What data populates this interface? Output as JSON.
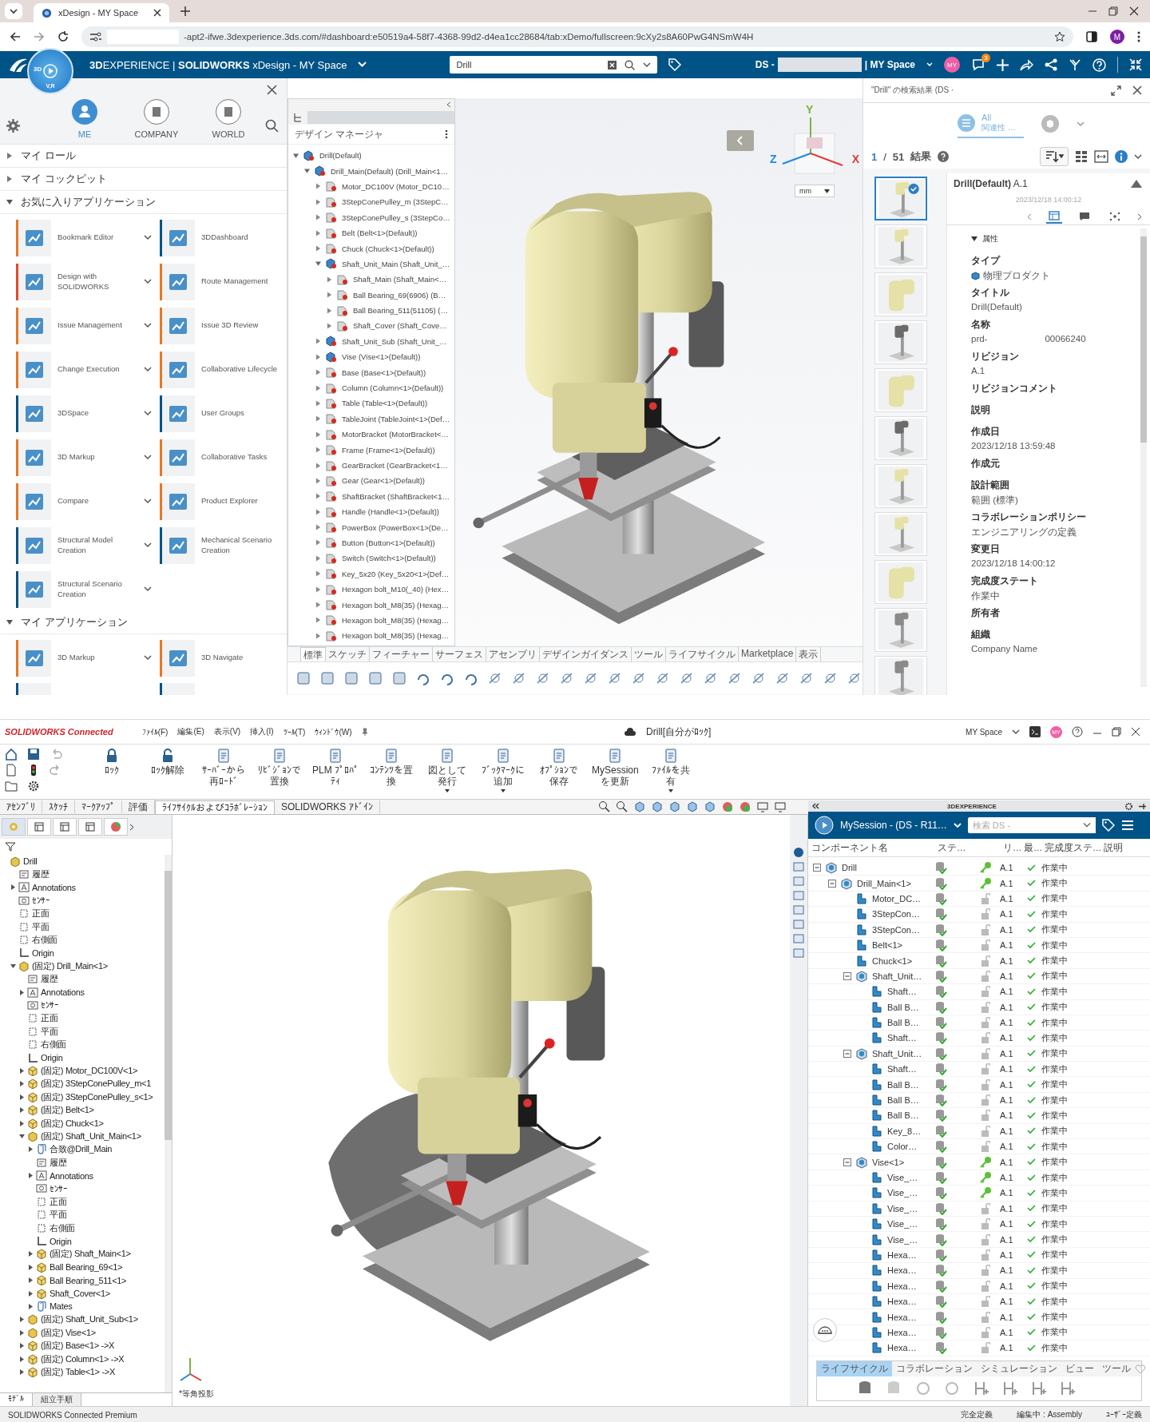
{
  "browser": {
    "tab_title": "xDesign - MY Space",
    "url": "-apt2-ifwe.3dexperience.3ds.com/#dashboard:e50519a4-58f7-4368-99d2-d4ea1cc28684/tab:xDemo/fullscreen:9cXy2s8A60PwG4NSmW4H",
    "profile": "M"
  },
  "header": {
    "title": "**3D**EXPERIENCE | **SOLIDWORKS** xDesign - MY Space",
    "compass_left": "3D",
    "compass_bottom": "V,R",
    "search_value": "Drill",
    "tenant": "DS -",
    "space": "| MY Space",
    "avatar": "MY",
    "notifications": "3"
  },
  "launcher": {
    "tabs": [
      {
        "label": "ME",
        "selected": true
      },
      {
        "label": "COMPANY",
        "selected": false
      },
      {
        "label": "WORLD",
        "selected": false
      }
    ],
    "sections": [
      {
        "title": "マイ ロール",
        "expanded": false
      },
      {
        "title": "マイ コックピット",
        "expanded": false
      },
      {
        "title": "お気に入りアプリケーション",
        "expanded": true,
        "apps": [
          {
            "name": "Bookmark Editor",
            "color": "#e87722"
          },
          {
            "name": "3DDashboard",
            "color": "#005386"
          },
          {
            "name": "Design with SOLIDWORKS",
            "color": "#e2492c"
          },
          {
            "name": "Route Management",
            "color": "#e87722"
          },
          {
            "name": "Issue Management",
            "color": "#e87722"
          },
          {
            "name": "Issue 3D Review",
            "color": "#e87722"
          },
          {
            "name": "Change Execution",
            "color": "#e87722"
          },
          {
            "name": "Collaborative Lifecycle",
            "color": "#e87722"
          },
          {
            "name": "3DSpace",
            "color": "#005386"
          },
          {
            "name": "User Groups",
            "color": "#005386"
          },
          {
            "name": "3D Markup",
            "color": "#e87722"
          },
          {
            "name": "Collaborative Tasks",
            "color": "#e87722"
          },
          {
            "name": "Compare",
            "color": "#e87722"
          },
          {
            "name": "Product Explorer",
            "color": "#e87722"
          },
          {
            "name": "Structural Model Creation",
            "color": "#005386"
          },
          {
            "name": "Mechanical Scenario Creation",
            "color": "#005386"
          },
          {
            "name": "Structural Scenario Creation",
            "color": "#005386"
          }
        ]
      },
      {
        "title": "マイ アプリケーション",
        "expanded": true,
        "apps": [
          {
            "name": "3D Markup",
            "color": "#e87722"
          },
          {
            "name": "3D Navigate",
            "color": "#e87722"
          }
        ]
      }
    ]
  },
  "design_manager": {
    "title": "デザイン マネージャ",
    "tree": [
      {
        "name": "Drill(Default)",
        "kind": "assembly",
        "expanded": true,
        "children": [
          {
            "name": "Drill_Main(Default) (Drill_Main<1…",
            "kind": "assembly",
            "expanded": true,
            "children": [
              {
                "name": "Motor_DC100V (Motor_DC10…",
                "kind": "part",
                "expanded": false
              },
              {
                "name": "3StepConePulley_m (3StepC…",
                "kind": "part",
                "expanded": false
              },
              {
                "name": "3StepConePulley_s (3StepCo…",
                "kind": "part",
                "expanded": false
              },
              {
                "name": "Belt (Belt<1>(Default))",
                "kind": "part",
                "expanded": false
              },
              {
                "name": "Chuck (Chuck<1>(Default))",
                "kind": "part",
                "expanded": false
              },
              {
                "name": "Shaft_Unit_Main (Shaft_Unit_…",
                "kind": "assembly",
                "expanded": true,
                "children": [
                  {
                    "name": "Shaft_Main (Shaft_Main<…",
                    "kind": "part",
                    "expanded": false
                  },
                  {
                    "name": "Ball Bearing_69(6906) (B…",
                    "kind": "part",
                    "expanded": false
                  },
                  {
                    "name": "Ball Bearing_511(51105) (…",
                    "kind": "part",
                    "expanded": false
                  },
                  {
                    "name": "Shaft_Cover (Shaft_Cove…",
                    "kind": "part",
                    "expanded": false
                  }
                ]
              },
              {
                "name": "Shaft_Unit_Sub (Shaft_Unit_…",
                "kind": "assembly",
                "expanded": false
              },
              {
                "name": "Vise (Vise<1>(Default))",
                "kind": "assembly",
                "expanded": false
              },
              {
                "name": "Base (Base<1>(Default))",
                "kind": "part",
                "expanded": false
              },
              {
                "name": "Column (Column<1>(Default))",
                "kind": "part",
                "expanded": false
              },
              {
                "name": "Table (Table<1>(Default))",
                "kind": "part",
                "expanded": false
              },
              {
                "name": "TableJoint (TableJoint<1>(Def…",
                "kind": "part",
                "expanded": false
              },
              {
                "name": "MotorBracket (MotorBracket<…",
                "kind": "part",
                "expanded": false
              },
              {
                "name": "Frame (Frame<1>(Default))",
                "kind": "part",
                "expanded": false
              },
              {
                "name": "GearBracket (GearBracket<1…",
                "kind": "part",
                "expanded": false
              },
              {
                "name": "Gear (Gear<1>(Default))",
                "kind": "part",
                "expanded": false
              },
              {
                "name": "ShaftBracket (ShaftBracket<1…",
                "kind": "part",
                "expanded": false
              },
              {
                "name": "Handle (Handle<1>(Default))",
                "kind": "part",
                "expanded": false
              },
              {
                "name": "PowerBox (PowerBox<1>(De…",
                "kind": "part",
                "expanded": false
              },
              {
                "name": "Button (Button<1>(Default))",
                "kind": "part",
                "expanded": false
              },
              {
                "name": "Switch (Switch<1>(Default))",
                "kind": "part",
                "expanded": false
              },
              {
                "name": "Key_5x20 (Key_5x20<1>(Def…",
                "kind": "part",
                "expanded": false
              },
              {
                "name": "Hexagon bolt_M10(_40) (Hex…",
                "kind": "part",
                "expanded": false
              },
              {
                "name": "Hexagon bolt_M8(35) (Hexag…",
                "kind": "part",
                "expanded": false
              },
              {
                "name": "Hexagon bolt_M8(35) (Hexag…",
                "kind": "part",
                "expanded": false
              },
              {
                "name": "Hexagon bolt_M8(35) (Hexag…",
                "kind": "part",
                "expanded": false
              }
            ]
          }
        ]
      }
    ]
  },
  "viewport": {
    "unit": "mm",
    "axes": {
      "x": "X",
      "y": "Y",
      "z": "Z"
    }
  },
  "xdesign_toolbar": {
    "tabs": [
      {
        "label": "標準",
        "selected": true
      },
      {
        "label": "スケッチ",
        "selected": false
      },
      {
        "label": "フィーチャー",
        "selected": false
      },
      {
        "label": "サーフェス",
        "selected": false
      },
      {
        "label": "アセンブリ",
        "selected": false
      },
      {
        "label": "デザインガイダンス",
        "selected": false
      },
      {
        "label": "ツール",
        "selected": false
      },
      {
        "label": "ライフサイクル",
        "selected": false
      },
      {
        "label": "Marketplace",
        "selected": false
      },
      {
        "label": "表示",
        "selected": false
      }
    ]
  },
  "search": {
    "title": "\"Drill\" の検索結果 (DS ·",
    "filter": "All",
    "sort": "関連性 …",
    "page": "1",
    "separator": "/",
    "total": "51",
    "results_label": "結果",
    "results": [
      {
        "kind": "yellow",
        "selected": true
      },
      {
        "kind": "yellow",
        "selected": false
      },
      {
        "kind": "head",
        "selected": false
      },
      {
        "kind": "dark",
        "selected": false
      },
      {
        "kind": "head",
        "selected": false
      },
      {
        "kind": "dark",
        "selected": false
      },
      {
        "kind": "yellow",
        "selected": false
      },
      {
        "kind": "yellow",
        "selected": false
      },
      {
        "kind": "head",
        "selected": false
      },
      {
        "kind": "gray",
        "selected": false
      },
      {
        "kind": "gray",
        "selected": false
      }
    ],
    "detail": {
      "title": "Drill(Default)",
      "revision": "A.1",
      "date": "2023/12/18 14:00:12",
      "section": "属性",
      "section_expanded": true,
      "properties": [
        {
          "label": "タイプ",
          "value": "物理プロダクト",
          "kind": "type"
        },
        {
          "label": "タイトル",
          "value": "Drill(Default)",
          "kind": "text"
        },
        {
          "label": "名称",
          "value": "prd-",
          "value_2": "00066240",
          "kind": "text"
        },
        {
          "label": "リビジョン",
          "value": "A.1",
          "kind": "text"
        },
        {
          "label": "リビジョンコメント",
          "kind": "text"
        },
        {
          "label": "説明",
          "kind": "text"
        },
        {
          "label": "作成日",
          "value": "2023/12/18 13:59:48",
          "kind": "text"
        },
        {
          "label": "作成元",
          "kind": "text"
        },
        {
          "label": "設計範囲",
          "value": "範囲 (標準)",
          "kind": "text"
        },
        {
          "label": "コラボレーションポリシー",
          "value": "エンジニアリングの定義",
          "kind": "text"
        },
        {
          "label": "変更日",
          "value": "2023/12/18 14:00:12",
          "kind": "text"
        },
        {
          "label": "完成度ステート",
          "value": "作業中",
          "kind": "text"
        },
        {
          "label": "所有者",
          "kind": "text"
        },
        {
          "label": "組織",
          "value": "Company Name",
          "kind": "text"
        }
      ]
    }
  },
  "solidworks": {
    "brand": "SOLIDWORKS Connected",
    "menus": [
      "ﾌｧｲﾙ(F)",
      "編集(E)",
      "表示(V)",
      "挿入(I)",
      "ﾂｰﾙ(T)",
      "ｳｨﾝﾄﾞｳ(W)"
    ],
    "doc_title": "Drill[自分がﾛｯｸ]",
    "space": "MY Space",
    "avatar": "MY",
    "ribbon": [
      {
        "label": "ﾛｯｸ",
        "dropdown": false
      },
      {
        "label": "ﾛｯｸ解除",
        "dropdown": false
      },
      {
        "label": "ｻｰﾊﾞｰから再ﾛｰﾄﾞ",
        "dropdown": false
      },
      {
        "label": "ﾘﾋﾞｼﾞｮﾝで置換",
        "dropdown": false
      },
      {
        "label": "PLM ﾌﾟﾛﾊﾟﾃｨ",
        "dropdown": false
      },
      {
        "label": "ｺﾝﾃﾝﾂを置換",
        "dropdown": false
      },
      {
        "label": "図として発行",
        "dropdown": true
      },
      {
        "label": "ﾌﾞｯｸﾏｰｸに追加",
        "dropdown": true
      },
      {
        "label": "ｵﾌﾟｼｮﾝで保存",
        "dropdown": false
      },
      {
        "label": "MySessionを更新",
        "dropdown": false
      },
      {
        "label": "ﾌｧｲﾙを共有",
        "dropdown": true
      }
    ],
    "manager_tabs": [
      {
        "selected": true
      },
      {
        "selected": false
      },
      {
        "selected": false
      },
      {
        "selected": false
      },
      {
        "selected": false
      }
    ],
    "tabs": [
      {
        "label": "ｱｾﾝﾌﾞﾘ",
        "selected": false
      },
      {
        "label": "ｽｹｯﾁ",
        "selected": false
      },
      {
        "label": "ﾏｰｸｱｯﾌﾟ",
        "selected": false
      },
      {
        "label": "評価",
        "selected": false
      },
      {
        "label": "ﾗｲﾌｻｲｸﾙおよびｺﾗﾎﾞﾚｰｼｮﾝ",
        "selected": true
      },
      {
        "label": "SOLIDWORKS ｱﾄﾞｲﾝ",
        "selected": false
      }
    ],
    "feature_tree": [
      {
        "name": "Drill",
        "kind": "assembly",
        "children": [
          {
            "name": "履歴",
            "kind": "history"
          },
          {
            "name": "Annotations",
            "kind": "annotations",
            "expanded": false
          },
          {
            "name": "ｾﾝｻｰ",
            "kind": "sensor"
          },
          {
            "name": "正面",
            "kind": "plane"
          },
          {
            "name": "平面",
            "kind": "plane"
          },
          {
            "name": "右側面",
            "kind": "plane"
          },
          {
            "name": "Origin",
            "kind": "origin"
          },
          {
            "name": "(固定) Drill_Main<1>",
            "kind": "assembly",
            "expanded": true,
            "children": [
              {
                "name": "履歴",
                "kind": "history"
              },
              {
                "name": "Annotations",
                "kind": "annotations",
                "expanded": false
              },
              {
                "name": "ｾﾝｻｰ",
                "kind": "sensor"
              },
              {
                "name": "正面",
                "kind": "plane"
              },
              {
                "name": "平面",
                "kind": "plane"
              },
              {
                "name": "右側面",
                "kind": "plane"
              },
              {
                "name": "Origin",
                "kind": "origin"
              },
              {
                "name": "(固定) Motor_DC100V<1>",
                "kind": "part",
                "expanded": false
              },
              {
                "name": "(固定) 3StepConePulley_m<1",
                "kind": "part",
                "expanded": false
              },
              {
                "name": "(固定) 3StepConePulley_s<1>",
                "kind": "part",
                "expanded": false
              },
              {
                "name": "(固定) Belt<1>",
                "kind": "part",
                "expanded": false
              },
              {
                "name": "(固定) Chuck<1>",
                "kind": "part",
                "expanded": false
              },
              {
                "name": "(固定) Shaft_Unit_Main<1>",
                "kind": "assembly",
                "expanded": true,
                "children": [
                  {
                    "name": "合致@Drill_Main",
                    "kind": "mates",
                    "expanded": false
                  },
                  {
                    "name": "履歴",
                    "kind": "history"
                  },
                  {
                    "name": "Annotations",
                    "kind": "annotations",
                    "expanded": false
                  },
                  {
                    "name": "ｾﾝｻｰ",
                    "kind": "sensor"
                  },
                  {
                    "name": "正面",
                    "kind": "plane"
                  },
                  {
                    "name": "平面",
                    "kind": "plane"
                  },
                  {
                    "name": "右側面",
                    "kind": "plane"
                  },
                  {
                    "name": "Origin",
                    "kind": "origin"
                  },
                  {
                    "name": "(固定) Shaft_Main<1>",
                    "kind": "part",
                    "expanded": false
                  },
                  {
                    "name": "Ball Bearing_69<1>",
                    "kind": "part",
                    "expanded": false
                  },
                  {
                    "name": "Ball Bearing_511<1>",
                    "kind": "part",
                    "expanded": false
                  },
                  {
                    "name": "Shaft_Cover<1>",
                    "kind": "part",
                    "expanded": false
                  },
                  {
                    "name": "Mates",
                    "kind": "mates",
                    "expanded": false
                  }
                ]
              },
              {
                "name": "(固定) Shaft_Unit_Sub<1>",
                "kind": "assembly",
                "expanded": false
              },
              {
                "name": "(固定) Vise<1>",
                "kind": "assembly",
                "expanded": false
              },
              {
                "name": "(固定) Base<1> ->X",
                "kind": "part",
                "expanded": false
              },
              {
                "name": "(固定) Column<1> ->X",
                "kind": "part",
                "expanded": false
              },
              {
                "name": "(固定) Table<1> ->X",
                "kind": "part",
                "expanded": false
              }
            ]
          }
        ]
      }
    ],
    "view_label": "*等角投影",
    "bottom_tabs": [
      {
        "label": "ﾓﾃﾞﾙ",
        "selected": true
      },
      {
        "label": "組立手順",
        "selected": false
      }
    ],
    "status": {
      "product": "SOLIDWORKS Connected Premium",
      "items": [
        "完全定義",
        "編集中 : Assembly",
        "ﾕｰｻﾞｰ定義"
      ]
    }
  },
  "session": {
    "panel_title": "3DEXPERIENCE",
    "name": "MySession - (DS - R11…",
    "search_placeholder": "検索 DS -",
    "columns": [
      "コンポーネント名",
      "ステ…",
      "リ…",
      "最…",
      "完成度ステ…",
      "説明"
    ],
    "tree": [
      {
        "name": "Drill",
        "kind": "assembly",
        "locked": true,
        "revision": "A.1",
        "latest": true,
        "state": "作業中",
        "expanded": true,
        "children": [
          {
            "name": "Drill_Main<1>",
            "kind": "assembly",
            "locked": true,
            "revision": "A.1",
            "latest": true,
            "state": "作業中",
            "expanded": true,
            "children": [
              {
                "name": "Motor_DC…",
                "kind": "part",
                "locked": false,
                "revision": "A.1",
                "latest": true,
                "state": "作業中"
              },
              {
                "name": "3StepCon…",
                "kind": "part",
                "locked": false,
                "revision": "A.1",
                "latest": true,
                "state": "作業中"
              },
              {
                "name": "3StepCon…",
                "kind": "part",
                "locked": false,
                "revision": "A.1",
                "latest": true,
                "state": "作業中"
              },
              {
                "name": "Belt<1>",
                "kind": "part",
                "locked": false,
                "revision": "A.1",
                "latest": true,
                "state": "作業中"
              },
              {
                "name": "Chuck<1>",
                "kind": "part",
                "locked": false,
                "revision": "A.1",
                "latest": true,
                "state": "作業中"
              },
              {
                "name": "Shaft_Unit…",
                "kind": "assembly",
                "locked": false,
                "revision": "A.1",
                "latest": true,
                "state": "作業中",
                "expanded": true,
                "children": [
                  {
                    "name": "Shaft…",
                    "kind": "part",
                    "locked": false,
                    "revision": "A.1",
                    "latest": true,
                    "state": "作業中"
                  },
                  {
                    "name": "Ball B…",
                    "kind": "part",
                    "locked": false,
                    "revision": "A.1",
                    "latest": true,
                    "state": "作業中"
                  },
                  {
                    "name": "Ball B…",
                    "kind": "part",
                    "locked": false,
                    "revision": "A.1",
                    "latest": true,
                    "state": "作業中"
                  },
                  {
                    "name": "Shaft…",
                    "kind": "part",
                    "locked": false,
                    "revision": "A.1",
                    "latest": true,
                    "state": "作業中"
                  }
                ]
              },
              {
                "name": "Shaft_Unit…",
                "kind": "assembly",
                "locked": false,
                "revision": "A.1",
                "latest": true,
                "state": "作業中",
                "expanded": true,
                "children": [
                  {
                    "name": "Shaft…",
                    "kind": "part",
                    "locked": false,
                    "revision": "A.1",
                    "latest": true,
                    "state": "作業中"
                  },
                  {
                    "name": "Ball B…",
                    "kind": "part",
                    "locked": false,
                    "revision": "A.1",
                    "latest": true,
                    "state": "作業中"
                  },
                  {
                    "name": "Ball B…",
                    "kind": "part",
                    "locked": false,
                    "revision": "A.1",
                    "latest": true,
                    "state": "作業中"
                  },
                  {
                    "name": "Ball B…",
                    "kind": "part",
                    "locked": false,
                    "revision": "A.1",
                    "latest": true,
                    "state": "作業中"
                  },
                  {
                    "name": "Key_8…",
                    "kind": "part",
                    "locked": false,
                    "revision": "A.1",
                    "latest": true,
                    "state": "作業中"
                  },
                  {
                    "name": "Color…",
                    "kind": "part",
                    "locked": false,
                    "revision": "A.1",
                    "latest": true,
                    "state": "作業中"
                  }
                ]
              },
              {
                "name": "Vise<1>",
                "kind": "assembly",
                "locked": true,
                "revision": "A.1",
                "latest": true,
                "state": "作業中",
                "expanded": true,
                "children": [
                  {
                    "name": "Vise_…",
                    "kind": "part",
                    "locked": true,
                    "revision": "A.1",
                    "latest": true,
                    "state": "作業中"
                  },
                  {
                    "name": "Vise_…",
                    "kind": "part",
                    "locked": true,
                    "revision": "A.1",
                    "latest": true,
                    "state": "作業中"
                  },
                  {
                    "name": "Vise_…",
                    "kind": "part",
                    "locked": false,
                    "revision": "A.1",
                    "latest": true,
                    "state": "作業中"
                  },
                  {
                    "name": "Vise_…",
                    "kind": "part",
                    "locked": false,
                    "revision": "A.1",
                    "latest": true,
                    "state": "作業中"
                  },
                  {
                    "name": "Vise_…",
                    "kind": "part",
                    "locked": false,
                    "revision": "A.1",
                    "latest": true,
                    "state": "作業中"
                  },
                  {
                    "name": "Hexa…",
                    "kind": "part",
                    "locked": false,
                    "revision": "A.1",
                    "latest": true,
                    "state": "作業中"
                  },
                  {
                    "name": "Hexa…",
                    "kind": "part",
                    "locked": false,
                    "revision": "A.1",
                    "latest": true,
                    "state": "作業中"
                  },
                  {
                    "name": "Hexa…",
                    "kind": "part",
                    "locked": false,
                    "revision": "A.1",
                    "latest": true,
                    "state": "作業中"
                  },
                  {
                    "name": "Hexa…",
                    "kind": "part",
                    "locked": false,
                    "revision": "A.1",
                    "latest": true,
                    "state": "作業中"
                  },
                  {
                    "name": "Hexa…",
                    "kind": "part",
                    "locked": false,
                    "revision": "A.1",
                    "latest": true,
                    "state": "作業中"
                  },
                  {
                    "name": "Hexa…",
                    "kind": "part",
                    "locked": false,
                    "revision": "A.1",
                    "latest": true,
                    "state": "作業中"
                  },
                  {
                    "name": "Hexa…",
                    "kind": "part",
                    "locked": false,
                    "revision": "A.1",
                    "latest": true,
                    "state": "作業中"
                  }
                ]
              }
            ]
          }
        ]
      }
    ],
    "tabs": [
      {
        "label": "ライフサイクル",
        "selected": true
      },
      {
        "label": "コラボレーション",
        "selected": false
      },
      {
        "label": "シミュレーション",
        "selected": false
      },
      {
        "label": "ビュー",
        "selected": false
      },
      {
        "label": "ツール",
        "selected": false
      }
    ]
  }
}
